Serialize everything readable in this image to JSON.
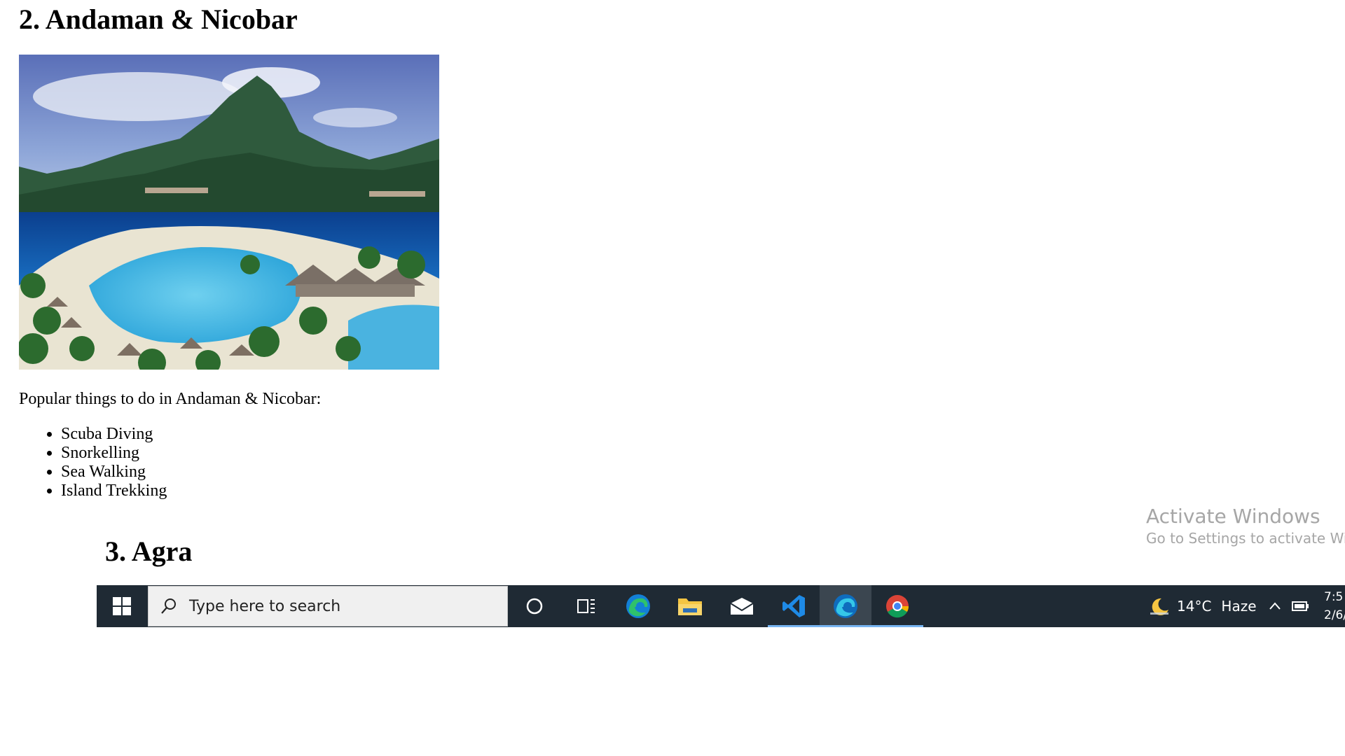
{
  "page": {
    "section2_heading": "2. Andaman & Nicobar",
    "intro": "Popular things to do in Andaman & Nicobar:",
    "activities": [
      "Scuba Diving",
      "Snorkelling",
      "Sea Walking",
      "Island Trekking"
    ],
    "section3_heading": "3. Agra"
  },
  "watermark": {
    "title": "Activate Windows",
    "subtitle": "Go to Settings to activate Windows."
  },
  "taskbar": {
    "search_placeholder": "Type here to search",
    "pinned": [
      {
        "icon": "cortana-icon"
      },
      {
        "icon": "task-view-icon"
      },
      {
        "icon": "edge-icon"
      },
      {
        "icon": "file-explorer-icon"
      },
      {
        "icon": "mail-icon"
      },
      {
        "icon": "vscode-icon",
        "running": true
      },
      {
        "icon": "edge-dev-icon",
        "running": true,
        "active": true
      },
      {
        "icon": "chrome-icon",
        "running": true
      }
    ],
    "weather": {
      "temp": "14°C",
      "condition": "Haze",
      "icon": "moon-icon"
    },
    "clock": {
      "time": "7:5",
      "date": "2/6/"
    }
  },
  "colors": {
    "taskbar_bg": "#1f2a34",
    "running_indicator": "#77b4f1"
  }
}
